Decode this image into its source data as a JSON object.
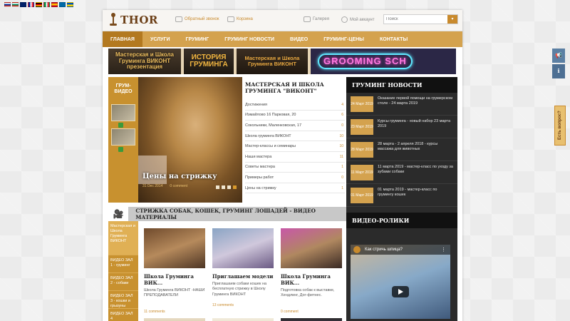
{
  "flags": [
    "#d52b1e",
    "#0039a6",
    "#00966e",
    "#012169",
    "#002395",
    "#000000",
    "#009246",
    "#c60b1e",
    "#006aa7",
    "#0057b7"
  ],
  "header": {
    "logo_text": "THOR",
    "feedback_link": "Обратный звонок",
    "cart_link": "Корзина",
    "gallery_link": "Галерея",
    "login_link": "Мой аккаунт",
    "search_placeholder": "Поиск"
  },
  "nav": [
    {
      "label": "Главная",
      "active": true
    },
    {
      "label": "Услуги"
    },
    {
      "label": "Груминг"
    },
    {
      "label": "Груминг новости"
    },
    {
      "label": "Видео"
    },
    {
      "label": "Груминг-цены"
    },
    {
      "label": "Контакты"
    }
  ],
  "banners": {
    "b1": "Мастерская и Школа Груминга ВИКОНТ презентация",
    "b2": "ИСТОРИЯ ГРУМИНГА",
    "b3": "Мастерская и Школа Груминга ВИКОНТ",
    "b4": "GROOMING SCH"
  },
  "slider": {
    "col_title": "ГРУМ-ВИДЕО",
    "caption": "Цены на стрижку",
    "date": "31 Dec 2014",
    "comments": "0 comment"
  },
  "school": {
    "title": "МАСТЕРСКАЯ И ШКОЛА ГРУМИНГА \"ВИКОНТ\"",
    "items": [
      {
        "label": "Достижения",
        "count": "4"
      },
      {
        "label": "Измайлово 16 Парковая, 20",
        "count": "6"
      },
      {
        "label": "Сокольники, Маленковская, 17",
        "count": "0"
      },
      {
        "label": "Школа груминга ВИКОНТ",
        "count": "10"
      },
      {
        "label": "Мастер-классы и семинары",
        "count": "10"
      },
      {
        "label": "Наши мастера",
        "count": "11"
      },
      {
        "label": "Советы мастера",
        "count": "1"
      },
      {
        "label": "Примеры работ",
        "count": "0"
      },
      {
        "label": "Цены на стрижку",
        "count": "1"
      }
    ]
  },
  "news": {
    "title": "ГРУМИНГ НОВОСТИ",
    "items": [
      {
        "date": "24 Март 2019",
        "text": "Оказание первой помощи на грумерском столе - 24 марта 2019"
      },
      {
        "date": "23 Март 2019",
        "text": "Курсы груминга - новый набор 23 марта 2019"
      },
      {
        "date": "28 Март 2019",
        "text": "28 марта - 2 апреля 2018 - курсы массажа для животных"
      },
      {
        "date": "11 Март 2019",
        "text": "11 марта 2019 - мастер-класс по уходу за зубами собаки"
      },
      {
        "date": "01 Март 2019",
        "text": "01 марта 2019 - мастер-класс по грумингу кошек"
      }
    ]
  },
  "videos": {
    "title": "ВИДЕО-РОЛИКИ",
    "video_title": "Как стричь шпица?"
  },
  "section": {
    "title": "СТРИЖКА СОБАК, КОШЕК, ГРУМИНГ ЛОШАДЕЙ - ВИДЕО МАТЕРИАЛЫ",
    "tabs": [
      "Мастерская и Школа Груминга ВИКОНТ",
      "ВИДЕО ЗАЛ 1 - груминг",
      "ВИДЕО ЗАЛ 2 - собаки",
      "ВИДЕО ЗАЛ 3 - кошки и грызуны",
      "ВИДЕО ЗАЛ 4"
    ]
  },
  "cards": [
    {
      "title": "Школа Груминга ВИК...",
      "text": "Школа Груминга ВИКОНТ -НАШИ ПРЕПОДАВАТЕЛИ",
      "comments": "11 comments"
    },
    {
      "title": "Приглашаем модели",
      "text": "Приглашаем собаки кошек на бесплатную стрижку в Школу Груминга ВИКОНТ",
      "comments": "13 comments"
    },
    {
      "title": "Школа Груминга ВИК...",
      "text": "Подготовка собак к выставке, Хендлинг, Дог-фитнес.",
      "comments": "0 comment"
    }
  ],
  "feedback_tab": "Есть вопрос?",
  "colors": {
    "accent": "#d4a24e",
    "accent_dark": "#b37920",
    "dark_panel": "#2b2b2b"
  }
}
